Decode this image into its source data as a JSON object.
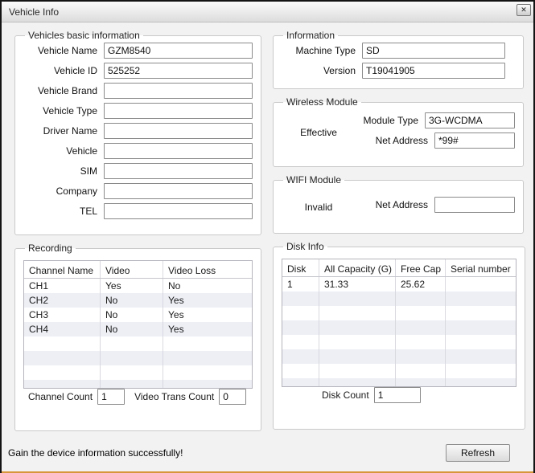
{
  "window": {
    "title": "Vehicle Info",
    "close_icon": "✕",
    "accent_color": "#d8963a"
  },
  "basic_info": {
    "title": "Vehicles basic information",
    "fields": [
      {
        "label": "Vehicle Name",
        "value": "GZM8540"
      },
      {
        "label": "Vehicle ID",
        "value": "525252"
      },
      {
        "label": "Vehicle Brand",
        "value": ""
      },
      {
        "label": "Vehicle Type",
        "value": ""
      },
      {
        "label": "Driver Name",
        "value": ""
      },
      {
        "label": "Vehicle",
        "value": ""
      },
      {
        "label": "SIM",
        "value": ""
      },
      {
        "label": "Company",
        "value": ""
      },
      {
        "label": "TEL",
        "value": ""
      }
    ]
  },
  "information": {
    "title": "Information",
    "fields": [
      {
        "label": "Machine Type",
        "value": "SD"
      },
      {
        "label": "Version",
        "value": "T19041905"
      }
    ]
  },
  "wireless_module": {
    "title": "Wireless Module",
    "status": "Effective",
    "fields": [
      {
        "label": "Module Type",
        "value": "3G-WCDMA"
      },
      {
        "label": "Net Address",
        "value": "*99#"
      }
    ]
  },
  "wifi_module": {
    "title": "WIFI Module",
    "status": "Invalid",
    "fields": [
      {
        "label": "Net Address",
        "value": ""
      }
    ]
  },
  "recording": {
    "title": "Recording",
    "table": {
      "headers": [
        "Channel Name",
        "Video",
        "Video Loss"
      ],
      "rows": [
        [
          "CH1",
          "Yes",
          "No"
        ],
        [
          "CH2",
          "No",
          "Yes"
        ],
        [
          "CH3",
          "No",
          "Yes"
        ],
        [
          "CH4",
          "No",
          "Yes"
        ]
      ]
    },
    "channel_count_label": "Channel Count",
    "channel_count": "1",
    "video_trans_label": "Video Trans Count",
    "video_trans_count": "0"
  },
  "disk_info": {
    "title": "Disk Info",
    "table": {
      "headers": [
        "Disk",
        "All Capacity (G)",
        "Free Cap",
        "Serial number"
      ],
      "rows": [
        [
          "1",
          "31.33",
          "25.62",
          ""
        ]
      ]
    },
    "disk_count_label": "Disk Count",
    "disk_count": "1"
  },
  "footer": {
    "status_message": "Gain the device information successfully!",
    "refresh_label": "Refresh"
  }
}
